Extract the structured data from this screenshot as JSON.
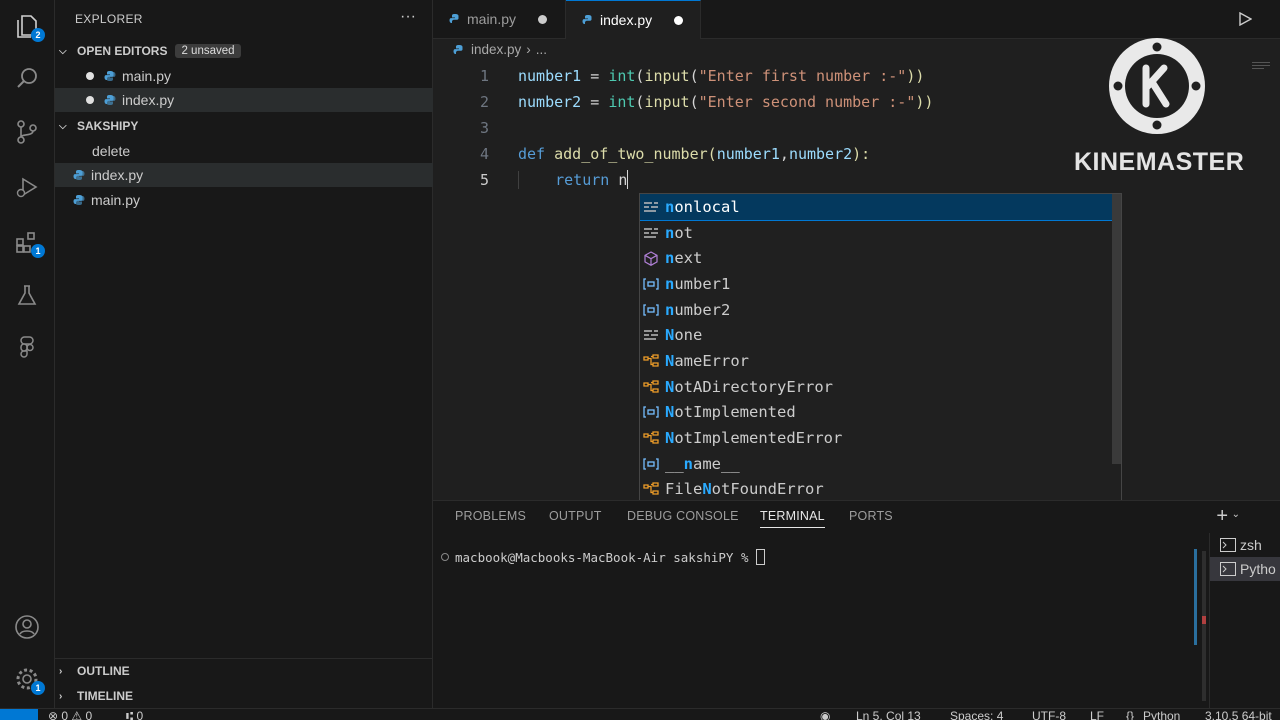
{
  "activity_bar": {
    "explorer_badge": "2",
    "extensions_badge": "1",
    "settings_badge": "1"
  },
  "sidebar": {
    "title": "EXPLORER",
    "more": "···",
    "open_editors": {
      "label": "OPEN EDITORS",
      "badge": "2 unsaved",
      "items": [
        {
          "label": "main.py"
        },
        {
          "label": "index.py"
        }
      ]
    },
    "folder": {
      "label": "SAKSHIPY",
      "items": [
        {
          "label": "delete"
        },
        {
          "label": "index.py"
        },
        {
          "label": "main.py"
        }
      ]
    },
    "outline_label": "OUTLINE",
    "timeline_label": "TIMELINE"
  },
  "tabs": [
    {
      "label": "main.py"
    },
    {
      "label": "index.py"
    }
  ],
  "breadcrumb": {
    "file": "index.py",
    "more": "..."
  },
  "code": {
    "line_numbers": [
      "1",
      "2",
      "3",
      "4",
      "5"
    ],
    "line1": {
      "var": "number1",
      "op": " = ",
      "fn1": "int",
      "p1": "(",
      "fn2": "input",
      "p2": "(",
      "str": "\"Enter first number :-\"",
      "close": "))"
    },
    "line2": {
      "var": "number2",
      "op": " = ",
      "fn1": "int",
      "p1": "(",
      "fn2": "input",
      "p2": "(",
      "str": "\"Enter second number :-\"",
      "close": "))"
    },
    "line4": {
      "kw": "def",
      "fn": "add_of_two_number",
      "p1": "(",
      "a1": "number1",
      "comma": ",",
      "a2": "number2",
      "close": "):"
    },
    "line5": {
      "kw": "return",
      "typed": "n"
    }
  },
  "suggestions": [
    {
      "hl": "n",
      "rest": "onlocal",
      "icon": "keyword-icon"
    },
    {
      "hl": "n",
      "rest": "ot",
      "icon": "keyword-icon"
    },
    {
      "hl": "n",
      "rest": "ext",
      "icon": "method-icon"
    },
    {
      "hl": "n",
      "rest": "umber1",
      "icon": "variable-icon"
    },
    {
      "hl": "n",
      "rest": "umber2",
      "icon": "variable-icon"
    },
    {
      "hl": "N",
      "rest": "one",
      "icon": "keyword-icon"
    },
    {
      "hl": "N",
      "rest": "ameError",
      "icon": "class-icon"
    },
    {
      "hl": "N",
      "rest": "otADirectoryError",
      "icon": "class-icon"
    },
    {
      "hl": "N",
      "rest": "otImplemented",
      "icon": "variable-icon"
    },
    {
      "hl": "N",
      "rest": "otImplementedError",
      "icon": "class-icon"
    },
    {
      "pre": "__",
      "hl": "n",
      "rest": "ame__",
      "icon": "variable-icon"
    },
    {
      "pre": "File",
      "hl": "N",
      "rest": "otFoundError",
      "icon": "class-icon"
    }
  ],
  "panel": {
    "tabs": [
      "PROBLEMS",
      "OUTPUT",
      "DEBUG CONSOLE",
      "TERMINAL",
      "PORTS"
    ],
    "terminal_prompt": "macbook@Macbooks-MacBook-Air sakshiPY % ",
    "terminals": [
      "zsh",
      "Pytho"
    ]
  },
  "watermark": {
    "text": "KINEMASTER"
  },
  "status_bar": {
    "problems": "⊗ 0 ⚠ 0",
    "ports": "⑆ 0",
    "position": "Ln 5, Col 13",
    "spaces": "Spaces: 4",
    "encoding": "UTF-8",
    "eol": "LF",
    "language": "Python",
    "interpreter": "3.10.5 64-bit"
  },
  "colors": {
    "accent": "#0078d4",
    "selection": "#04395e"
  }
}
